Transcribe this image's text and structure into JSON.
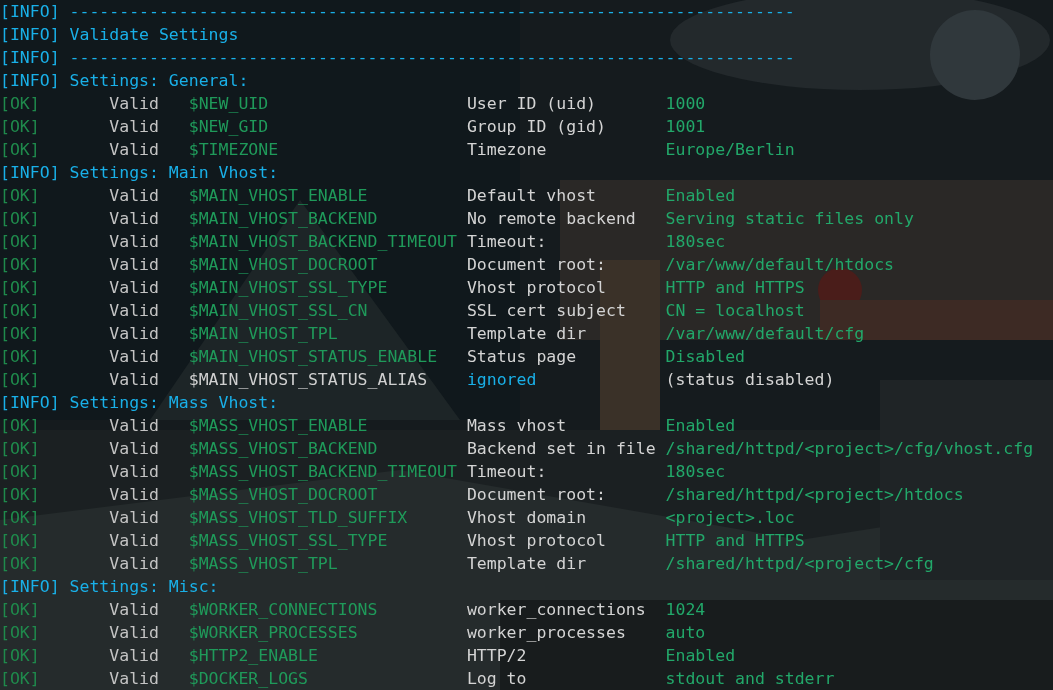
{
  "lines": [
    {
      "kind": "info",
      "tag": "[INFO]",
      "text": "-------------------------------------------------------------------------"
    },
    {
      "kind": "info",
      "tag": "[INFO]",
      "text": "Validate Settings"
    },
    {
      "kind": "info",
      "tag": "[INFO]",
      "text": "-------------------------------------------------------------------------"
    },
    {
      "kind": "info",
      "tag": "[INFO]",
      "text": "Settings: General:"
    },
    {
      "kind": "ok",
      "tag": "[OK]",
      "status": "Valid",
      "variable": "$NEW_UID",
      "label": "User ID (uid)",
      "value": "1000",
      "active": true
    },
    {
      "kind": "ok",
      "tag": "[OK]",
      "status": "Valid",
      "variable": "$NEW_GID",
      "label": "Group ID (gid)",
      "value": "1001",
      "active": true
    },
    {
      "kind": "ok",
      "tag": "[OK]",
      "status": "Valid",
      "variable": "$TIMEZONE",
      "label": "Timezone",
      "value": "Europe/Berlin",
      "active": true
    },
    {
      "kind": "info",
      "tag": "[INFO]",
      "text": "Settings: Main Vhost:"
    },
    {
      "kind": "ok",
      "tag": "[OK]",
      "status": "Valid",
      "variable": "$MAIN_VHOST_ENABLE",
      "label": "Default vhost",
      "value": "Enabled",
      "active": true
    },
    {
      "kind": "ok",
      "tag": "[OK]",
      "status": "Valid",
      "variable": "$MAIN_VHOST_BACKEND",
      "label": "No remote backend",
      "value": "Serving static files only",
      "active": true
    },
    {
      "kind": "ok",
      "tag": "[OK]",
      "status": "Valid",
      "variable": "$MAIN_VHOST_BACKEND_TIMEOUT",
      "label": "Timeout:",
      "value": "180sec",
      "active": true
    },
    {
      "kind": "ok",
      "tag": "[OK]",
      "status": "Valid",
      "variable": "$MAIN_VHOST_DOCROOT",
      "label": "Document root:",
      "value": "/var/www/default/htdocs",
      "active": true
    },
    {
      "kind": "ok",
      "tag": "[OK]",
      "status": "Valid",
      "variable": "$MAIN_VHOST_SSL_TYPE",
      "label": "Vhost protocol",
      "value": "HTTP and HTTPS",
      "active": true
    },
    {
      "kind": "ok",
      "tag": "[OK]",
      "status": "Valid",
      "variable": "$MAIN_VHOST_SSL_CN",
      "label": "SSL cert subject",
      "value": "CN = localhost",
      "active": true
    },
    {
      "kind": "ok",
      "tag": "[OK]",
      "status": "Valid",
      "variable": "$MAIN_VHOST_TPL",
      "label": "Template dir",
      "value": "/var/www/default/cfg",
      "active": true
    },
    {
      "kind": "ok",
      "tag": "[OK]",
      "status": "Valid",
      "variable": "$MAIN_VHOST_STATUS_ENABLE",
      "label": "Status page",
      "value": "Disabled",
      "active": true
    },
    {
      "kind": "ok",
      "tag": "[OK]",
      "status": "Valid",
      "variable": "$MAIN_VHOST_STATUS_ALIAS",
      "label": "ignored",
      "value": "(status disabled)",
      "active": false
    },
    {
      "kind": "info",
      "tag": "[INFO]",
      "text": "Settings: Mass Vhost:"
    },
    {
      "kind": "ok",
      "tag": "[OK]",
      "status": "Valid",
      "variable": "$MASS_VHOST_ENABLE",
      "label": "Mass vhost",
      "value": "Enabled",
      "active": true
    },
    {
      "kind": "ok",
      "tag": "[OK]",
      "status": "Valid",
      "variable": "$MASS_VHOST_BACKEND",
      "label": "Backend set in file",
      "value": "/shared/httpd/<project>/cfg/vhost.cfg",
      "active": true
    },
    {
      "kind": "ok",
      "tag": "[OK]",
      "status": "Valid",
      "variable": "$MASS_VHOST_BACKEND_TIMEOUT",
      "label": "Timeout:",
      "value": "180sec",
      "active": true
    },
    {
      "kind": "ok",
      "tag": "[OK]",
      "status": "Valid",
      "variable": "$MASS_VHOST_DOCROOT",
      "label": "Document root:",
      "value": "/shared/httpd/<project>/htdocs",
      "active": true
    },
    {
      "kind": "ok",
      "tag": "[OK]",
      "status": "Valid",
      "variable": "$MASS_VHOST_TLD_SUFFIX",
      "label": "Vhost domain",
      "value": "<project>.loc",
      "active": true
    },
    {
      "kind": "ok",
      "tag": "[OK]",
      "status": "Valid",
      "variable": "$MASS_VHOST_SSL_TYPE",
      "label": "Vhost protocol",
      "value": "HTTP and HTTPS",
      "active": true
    },
    {
      "kind": "ok",
      "tag": "[OK]",
      "status": "Valid",
      "variable": "$MASS_VHOST_TPL",
      "label": "Template dir",
      "value": "/shared/httpd/<project>/cfg",
      "active": true
    },
    {
      "kind": "info",
      "tag": "[INFO]",
      "text": "Settings: Misc:"
    },
    {
      "kind": "ok",
      "tag": "[OK]",
      "status": "Valid",
      "variable": "$WORKER_CONNECTIONS",
      "label": "worker_connections",
      "value": "1024",
      "active": true
    },
    {
      "kind": "ok",
      "tag": "[OK]",
      "status": "Valid",
      "variable": "$WORKER_PROCESSES",
      "label": "worker_processes",
      "value": "auto",
      "active": true
    },
    {
      "kind": "ok",
      "tag": "[OK]",
      "status": "Valid",
      "variable": "$HTTP2_ENABLE",
      "label": "HTTP/2",
      "value": "Enabled",
      "active": true
    },
    {
      "kind": "ok",
      "tag": "[OK]",
      "status": "Valid",
      "variable": "$DOCKER_LOGS",
      "label": "Log to",
      "value": "stdout and stderr",
      "active": true
    }
  ]
}
